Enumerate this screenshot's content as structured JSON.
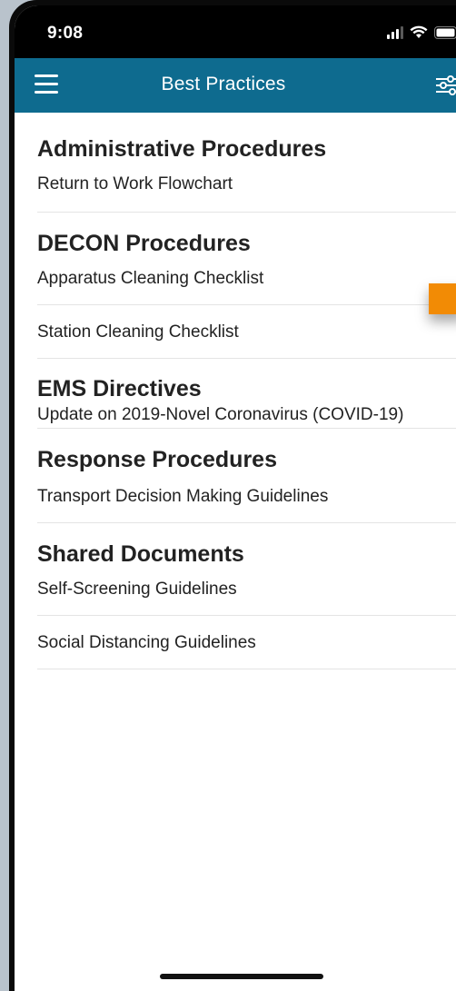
{
  "status_bar": {
    "time": "9:08"
  },
  "nav": {
    "title": "Best Practices",
    "menu_icon": "hamburger-menu-icon",
    "filter_icon": "sliders-filter-icon"
  },
  "sections": [
    {
      "title": "Administrative Procedures",
      "items": [
        "Return to Work Flowchart"
      ]
    },
    {
      "title": "DECON Procedures",
      "items": [
        "Apparatus Cleaning Checklist",
        "Station Cleaning Checklist"
      ]
    },
    {
      "title": "EMS Directives",
      "items": [
        "Update on 2019-Novel Coronavirus (COVID-19)"
      ]
    },
    {
      "title": "Response Procedures",
      "items": [
        "Transport Decision Making Guidelines"
      ]
    },
    {
      "title": "Shared Documents",
      "items": [
        "Self-Screening Guidelines",
        "Social Distancing Guidelines"
      ]
    }
  ],
  "colors": {
    "nav_background": "#0e6b8f",
    "status_background": "#000000",
    "accent_orange": "#f28b05",
    "text": "#222222"
  }
}
